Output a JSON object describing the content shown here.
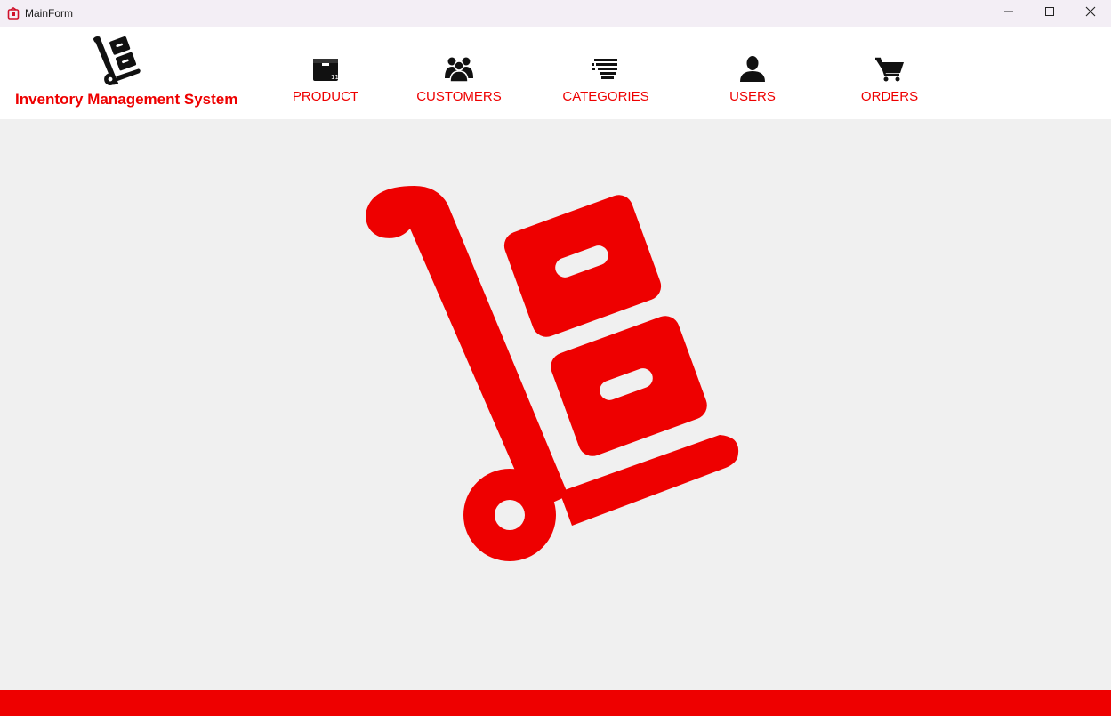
{
  "window": {
    "title": "MainForm",
    "icon": "app-red-icon",
    "controls": [
      "minimize-icon",
      "maximize-icon",
      "close-icon"
    ]
  },
  "header": {
    "app_name": "Inventory Management System",
    "logo_icon": "hand-truck-icon",
    "nav": [
      {
        "label": "PRODUCT",
        "icon": "box-icon"
      },
      {
        "label": "CUSTOMERS",
        "icon": "people-group-icon"
      },
      {
        "label": "CATEGORIES",
        "icon": "list-lines-icon"
      },
      {
        "label": "USERS",
        "icon": "user-icon"
      },
      {
        "label": "ORDERS",
        "icon": "cart-icon"
      }
    ]
  },
  "main": {
    "hero_icon": "hand-truck-icon"
  },
  "colors": {
    "accent": "#ee0000",
    "header_bg": "#ffffff",
    "content_bg": "#f0f0f0",
    "titlebar_bg": "#f3eef5",
    "footer": "#ee0000"
  }
}
